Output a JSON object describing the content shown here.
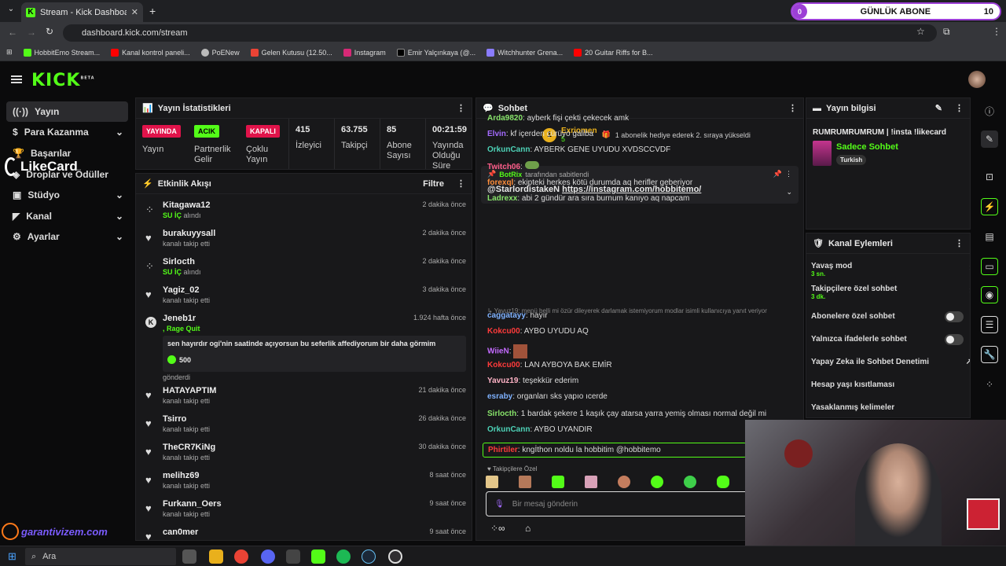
{
  "browser": {
    "tab_title": "Stream - Kick Dashboard",
    "url": "dashboard.kick.com/stream",
    "bookmarks": [
      "HobbitEmo Stream...",
      "Kanal kontrol paneli...",
      "PoENew",
      "Gelen Kutusu (12.50...",
      "Instagram",
      "Emir Yalçınkaya (@...",
      "Witchhunter Grena...",
      "20 Guitar Riffs for B..."
    ],
    "overlay_counter": "0",
    "overlay_label": "GÜNLÜK ABONE",
    "overlay_goal": "10"
  },
  "brand": "KICK",
  "brand_sup": "BETA",
  "sidebar": {
    "items": [
      {
        "label": "Yayın"
      },
      {
        "label": "Para Kazanma"
      },
      {
        "label": "Başarılar"
      },
      {
        "label": "Droplar ve Ödüller"
      },
      {
        "label": "Stüdyo"
      },
      {
        "label": "Kanal"
      },
      {
        "label": "Ayarlar"
      }
    ]
  },
  "overlay_likecard": "LikeCard",
  "overlay_garanti": "garantivizem.com",
  "stats": {
    "title": "Yayın İstatistikleri",
    "yayin_badge": "YAYINDA",
    "yayin_label": "Yayın",
    "partner_badge": "ACIK",
    "partner_label": "Partnerlik Gelir",
    "coklu_badge": "KAPALI",
    "coklu_label": "Çoklu Yayın",
    "viewers": "415",
    "viewers_label": "İzleyici",
    "followers": "63.755",
    "followers_label": "Takipçi",
    "subs": "85",
    "subs_label": "Abone Sayısı",
    "uptime": "00:21:59",
    "uptime_label": "Yayında Olduğu Süre"
  },
  "activity": {
    "title": "Etkinlik Akışı",
    "filter": "Filtre",
    "items": [
      {
        "name": "Kitagawa12",
        "sub": "SU İÇ",
        "sub2": " alındı",
        "time": "2 dakika önce",
        "icon": "redeem"
      },
      {
        "name": "burakuyysall",
        "sub": "",
        "sub2": "kanalı takip etti",
        "time": "2 dakika önce",
        "icon": "heart"
      },
      {
        "name": "Sirlocth",
        "sub": "SU İÇ",
        "sub2": " alındı",
        "time": "2 dakika önce",
        "icon": "redeem"
      },
      {
        "name": "Yagiz_02",
        "sub": "",
        "sub2": "kanalı takip etti",
        "time": "3 dakika önce",
        "icon": "heart"
      },
      {
        "name": "HATAYAPTIM",
        "sub": "",
        "sub2": "kanalı takip etti",
        "time": "21 dakika önce",
        "icon": "heart"
      },
      {
        "name": "Tsirro",
        "sub": "",
        "sub2": "kanalı takip etti",
        "time": "26 dakika önce",
        "icon": "heart"
      },
      {
        "name": "TheCR7KiNg",
        "sub": "",
        "sub2": "kanalı takip etti",
        "time": "30 dakika önce",
        "icon": "heart"
      },
      {
        "name": "melihz69",
        "sub": "",
        "sub2": "kanalı takip etti",
        "time": "8 saat önce",
        "icon": "heart"
      },
      {
        "name": "Furkann_Oers",
        "sub": "",
        "sub2": "kanalı takip etti",
        "time": "9 saat önce",
        "icon": "heart"
      },
      {
        "name": "can0mer",
        "sub": "",
        "sub2": "",
        "time": "9 saat önce",
        "icon": "heart"
      }
    ],
    "kick_item": {
      "name": "Jeneb1r",
      "sub": ", Rage Quit",
      "time": "1.924 hafta önce",
      "msg": "sen hayırdır ogi'nin saatinde açıyorsun bu seferlik affediyorum bir daha görmim",
      "amount": "500",
      "sent": "gönderdi"
    }
  },
  "chat": {
    "title": "Sohbet",
    "gift_user": "Exriomen",
    "gift_count": "5",
    "gift_text": "1 abonelik hediye ederek 2. sıraya yükseldi",
    "pinned_by": "BotRix",
    "pinned_suffix": "tarafından sabitlendi",
    "pinned_user": "@StarlordistakeN",
    "pinned_link": "https://instagram.com/hobbitemo/",
    "messages": [
      {
        "user": "Arda9820",
        "color": "#88e36b",
        "text": ": ayberk fişi çekti çekecek amk"
      },
      {
        "user": "Elvin",
        "color": "#a46bff",
        "text": ": kf içerden çürüyo galiba"
      },
      {
        "user": "OrkunCann",
        "color": "#4ed3b8",
        "text": ": AYBERK GENE UYUDU XVDSCCVDF"
      },
      {
        "user": "Twitch06",
        "color": "#ff5e8a",
        "text": ": "
      },
      {
        "user": "forexql",
        "color": "#ff8e3b",
        "text": ": ekipteki herkes kötü durumda aq herifler geberiyor"
      },
      {
        "user": "Ladrexx",
        "color": "#88e36b",
        "text": ": abi 2 gündür ara sıra burnum kanıyo aq napcam"
      },
      {
        "user": "caggatayy",
        "color": "#7fb2ff",
        "text": ": hayır"
      },
      {
        "user": "Kokcu00",
        "color": "#ff3b3b",
        "text": ": AYBO UYUDU AQ"
      },
      {
        "user": "WiieN",
        "color": "#c46bff",
        "text": ": "
      },
      {
        "user": "Kokcu00",
        "color": "#ff3b3b",
        "text": ": LAN AYBOYA BAK EMİR"
      },
      {
        "user": "Yavuz19",
        "color": "#ffb3c6",
        "text": ": teşekkür ederim"
      },
      {
        "user": "esraby",
        "color": "#7fb2ff",
        "text": ": organları sks yapıo ıcerde"
      },
      {
        "user": "Sirlocth",
        "color": "#88e36b",
        "text": ": 1 bardak şekere 1 kaşık çay atarsa yarra yemiş olması normal değil mi"
      },
      {
        "user": "OrkunCann",
        "color": "#4ed3b8",
        "text": ": AYBO UYANDIR"
      },
      {
        "user": "Phirtiler",
        "color": "#ff3b3b",
        "text": ": kngİthon noldu la hobbitim @hobbitemo"
      }
    ],
    "reply_note": "Yavuz19: menü belli mi özür dileyerek darlamak istemiyorum modlar isimli kullanıcıya yanıt veriyor",
    "followers_only": "Takipçilere Özel",
    "input_placeholder": "Bir mesaj gönderin"
  },
  "stream_info": {
    "title": "Yayın bilgisi",
    "stream_title": "RUMRUMRUMRUM | !insta !likecard",
    "category": "Sadece Sohbet",
    "language": "Turkish"
  },
  "channel_actions": {
    "title": "Kanal Eylemleri",
    "slow_mode": "Yavaş mod",
    "slow_value": "3 sn.",
    "followers_chat": "Takipçilere özel sohbet",
    "followers_value": "3 dk.",
    "subs_chat": "Abonelere özel sohbet",
    "emote_chat": "Yalnızca ifadelerle sohbet",
    "ai_mod": "Yapay Zeka ile Sohbet Denetimi",
    "age_limit": "Hesap yaşı kısıtlaması",
    "banned_words": "Yasaklanmış kelimeler"
  },
  "taskbar": {
    "search": "Ara"
  }
}
